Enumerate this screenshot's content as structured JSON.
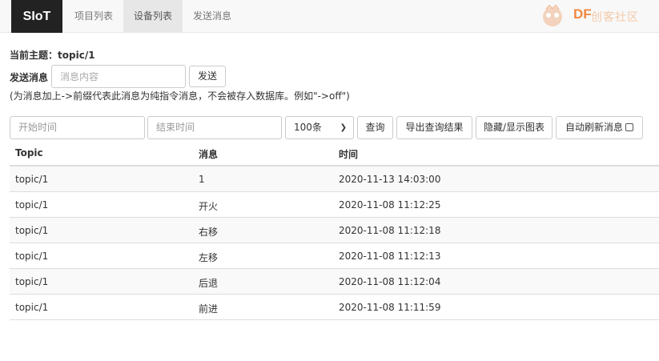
{
  "navbar": {
    "brand": "SIoT",
    "items": [
      {
        "label": "项目列表",
        "active": false
      },
      {
        "label": "设备列表",
        "active": true
      },
      {
        "label": "发送消息",
        "active": false
      }
    ],
    "logo_text": "DF",
    "logo_subtext": "创客社区"
  },
  "topic": {
    "label": "当前主题：",
    "value": "topic/1"
  },
  "send": {
    "label": "发送消息",
    "placeholder": "消息内容",
    "button": "发送",
    "hint": "(为消息加上->前缀代表此消息为纯指令消息，不会被存入数据库。例如\"->off\")"
  },
  "filters": {
    "start_placeholder": "开始时间",
    "end_placeholder": "结束时间",
    "limit_selected": "100条",
    "query_button": "查询",
    "export_button": "导出查询结果",
    "toggle_chart_button": "隐藏/显示图表",
    "auto_refresh_label": "自动刷新消息",
    "auto_refresh_checked": false
  },
  "table": {
    "headers": [
      "Topic",
      "消息",
      "时间"
    ],
    "rows": [
      {
        "topic": "topic/1",
        "message": "1",
        "time": "2020-11-13 14:03:00"
      },
      {
        "topic": "topic/1",
        "message": "开火",
        "time": "2020-11-08 11:12:25"
      },
      {
        "topic": "topic/1",
        "message": "右移",
        "time": "2020-11-08 11:12:18"
      },
      {
        "topic": "topic/1",
        "message": "左移",
        "time": "2020-11-08 11:12:13"
      },
      {
        "topic": "topic/1",
        "message": "后退",
        "time": "2020-11-08 11:12:04"
      },
      {
        "topic": "topic/1",
        "message": "前进",
        "time": "2020-11-08 11:11:59"
      }
    ]
  },
  "colors": {
    "navbar_bg": "#f8f8f8",
    "brand_bg": "#222222",
    "logo_orange": "#f08840",
    "stripe": "#f9f9f9"
  }
}
